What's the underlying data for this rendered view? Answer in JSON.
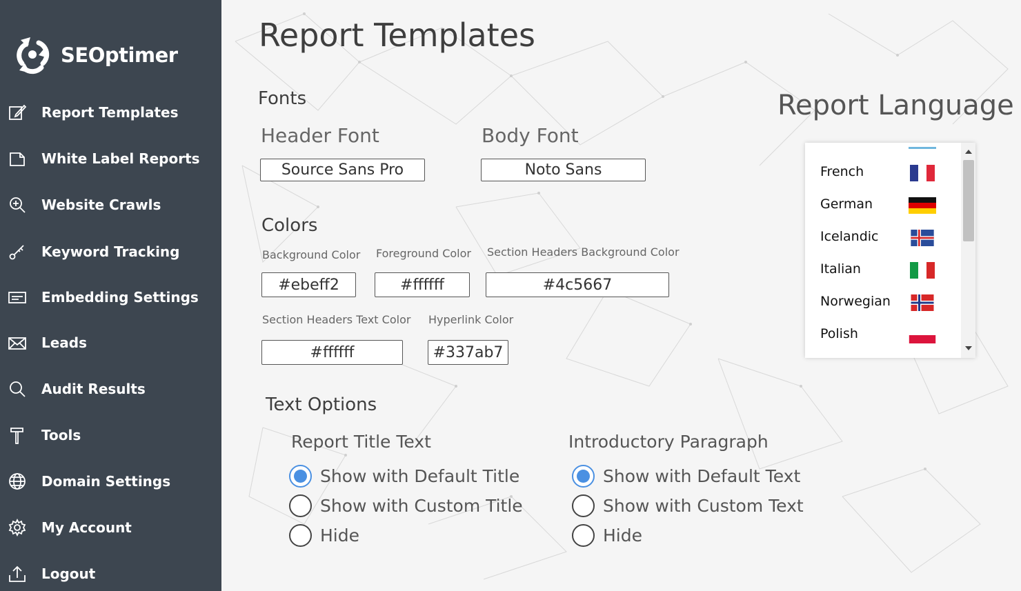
{
  "brand": {
    "name": "SEOptimer"
  },
  "sidebar": {
    "items": [
      {
        "label": "Report Templates",
        "icon": "edit-icon"
      },
      {
        "label": "White Label Reports",
        "icon": "document-icon"
      },
      {
        "label": "Website Crawls",
        "icon": "zoom-in-icon"
      },
      {
        "label": "Keyword Tracking",
        "icon": "key-icon"
      },
      {
        "label": "Embedding Settings",
        "icon": "embed-icon"
      },
      {
        "label": "Leads",
        "icon": "mail-icon"
      },
      {
        "label": "Audit Results",
        "icon": "search-icon"
      },
      {
        "label": "Tools",
        "icon": "hammer-icon"
      },
      {
        "label": "Domain Settings",
        "icon": "globe-icon"
      },
      {
        "label": "My Account",
        "icon": "gear-icon"
      },
      {
        "label": "Logout",
        "icon": "logout-icon"
      }
    ]
  },
  "main": {
    "title": "Report Templates",
    "fonts": {
      "section": "Fonts",
      "header_label": "Header Font",
      "header_value": "Source Sans Pro",
      "body_label": "Body Font",
      "body_value": "Noto Sans"
    },
    "colors": {
      "section": "Colors",
      "fields": [
        {
          "label": "Background Color",
          "value": "#ebeff2"
        },
        {
          "label": "Foreground Color",
          "value": "#ffffff"
        },
        {
          "label": "Section Headers Background Color",
          "value": "#4c5667"
        },
        {
          "label": "Section Headers Text Color",
          "value": "#ffffff"
        },
        {
          "label": "Hyperlink Color",
          "value": "#337ab7"
        }
      ]
    },
    "text_options": {
      "section": "Text Options",
      "report_title": {
        "label": "Report Title Text",
        "options": [
          "Show with Default Title",
          "Show with Custom Title",
          "Hide"
        ],
        "selected": 0
      },
      "intro_paragraph": {
        "label": "Introductory Paragraph",
        "options": [
          "Show with Default Text",
          "Show with Custom Text",
          "Hide"
        ],
        "selected": 0
      }
    },
    "language": {
      "title": "Report Language",
      "items": [
        {
          "name": "French",
          "flag": "fr"
        },
        {
          "name": "German",
          "flag": "de"
        },
        {
          "name": "Icelandic",
          "flag": "is"
        },
        {
          "name": "Italian",
          "flag": "it"
        },
        {
          "name": "Norwegian",
          "flag": "no"
        },
        {
          "name": "Polish",
          "flag": "pl"
        }
      ]
    }
  },
  "colors_theme": {
    "sidebar_bg": "#3d4650",
    "accent": "#4a90e2"
  }
}
